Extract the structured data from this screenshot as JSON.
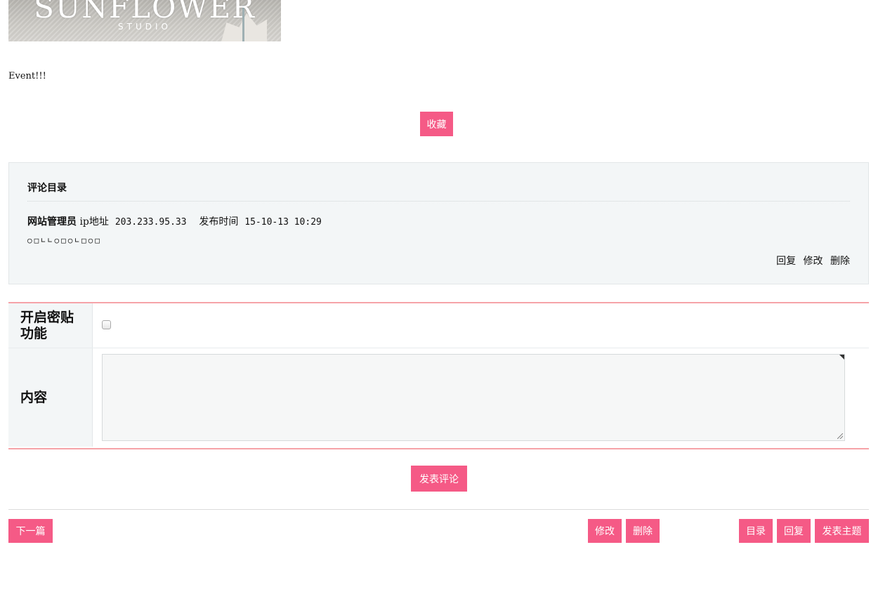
{
  "banner": {
    "logo_main": "SUNFLOWER",
    "logo_sub": "STUDIO"
  },
  "post": {
    "text": "Event!!!",
    "collect_label": "收藏"
  },
  "comments": {
    "heading": "评论目录",
    "items": [
      {
        "author": "网站管理员",
        "ip_label": "ip地址",
        "ip": "203.233.95.33",
        "time_label": "发布时间",
        "time": "15-10-13 10:29",
        "body": "○□∟∟○□○∟□○□",
        "reply_label": "回复",
        "edit_label": "修改",
        "delete_label": "删除"
      }
    ]
  },
  "form": {
    "secret_label": "开启密贴功能",
    "secret_line1": "开启密贴",
    "secret_line2": "功能",
    "content_label": "内容",
    "submit_label": "发表评论"
  },
  "footer": {
    "next_label": "下一篇",
    "edit_label": "修改",
    "delete_label": "删除",
    "list_label": "目录",
    "reply_label": "回复",
    "post_label": "发表主题"
  },
  "colors": {
    "accent": "#f55a86",
    "form_border": "#f6a3a8",
    "panel_bg": "#f3f6f7"
  }
}
